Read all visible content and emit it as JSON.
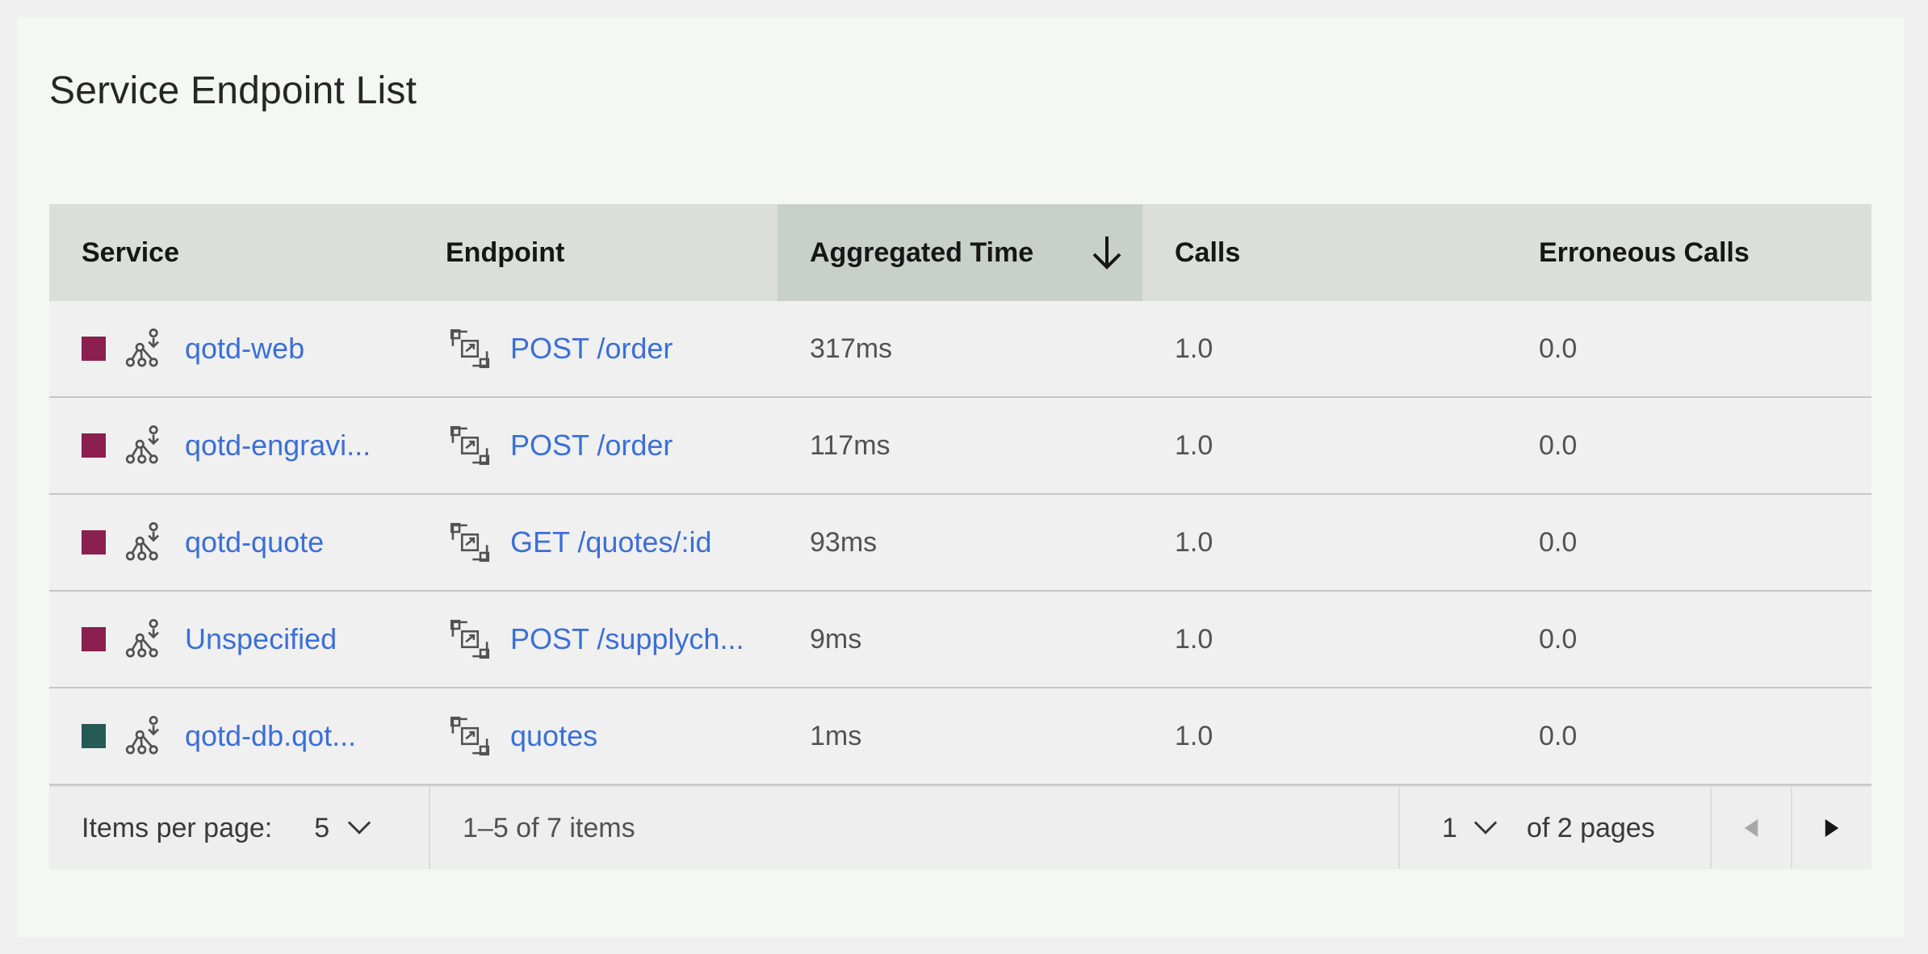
{
  "title": "Service Endpoint List",
  "columns": {
    "service": "Service",
    "endpoint": "Endpoint",
    "aggregated_time": "Aggregated Time",
    "calls": "Calls",
    "erroneous_calls": "Erroneous Calls"
  },
  "sort": {
    "column": "aggregated_time",
    "direction": "descending"
  },
  "rows": [
    {
      "swatch": "#8b1f4f",
      "service": "qotd-web",
      "endpoint": "POST /order",
      "aggregated_time": "317ms",
      "calls": "1.0",
      "erroneous_calls": "0.0"
    },
    {
      "swatch": "#8b1f4f",
      "service": "qotd-engravi...",
      "endpoint": "POST /order",
      "aggregated_time": "117ms",
      "calls": "1.0",
      "erroneous_calls": "0.0"
    },
    {
      "swatch": "#8b1f4f",
      "service": "qotd-quote",
      "endpoint": "GET /quotes/:id",
      "aggregated_time": "93ms",
      "calls": "1.0",
      "erroneous_calls": "0.0"
    },
    {
      "swatch": "#8b1f4f",
      "service": "Unspecified",
      "endpoint": "POST /supplych...",
      "aggregated_time": "9ms",
      "calls": "1.0",
      "erroneous_calls": "0.0"
    },
    {
      "swatch": "#255a55",
      "service": "qotd-db.qot...",
      "endpoint": "quotes",
      "aggregated_time": "1ms",
      "calls": "1.0",
      "erroneous_calls": "0.0"
    }
  ],
  "pagination": {
    "items_per_page_label": "Items per page:",
    "items_per_page": "5",
    "range_text": "1–5 of 7 items",
    "current_page": "1",
    "pages_text": "of 2 pages"
  },
  "colors": {
    "link": "#3b6fd8",
    "header_bg": "#dcdedb",
    "sorted_header_bg": "#c8d0c9"
  },
  "icons": {
    "service": "service-topology-icon",
    "endpoint": "endpoint-icon",
    "sort": "arrow-down-icon",
    "select": "chevron-down-icon",
    "prev": "caret-left-icon",
    "next": "caret-right-icon"
  }
}
